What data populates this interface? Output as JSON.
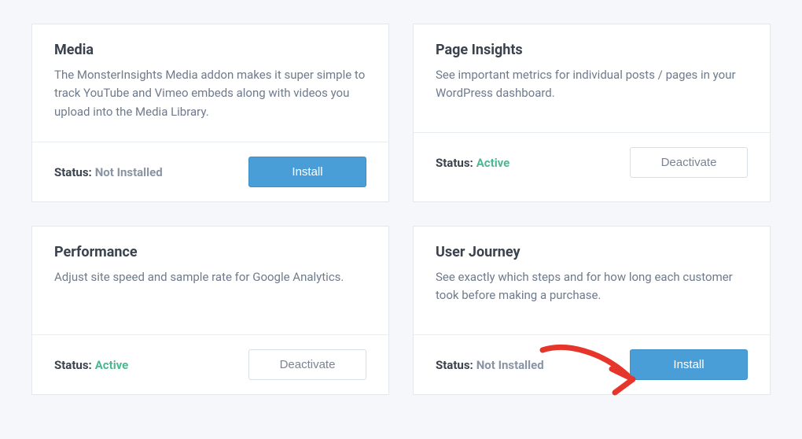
{
  "labels": {
    "status_prefix": "Status:"
  },
  "cards": [
    {
      "title": "Media",
      "description": "The MonsterInsights Media addon makes it super simple to track YouTube and Vimeo embeds along with videos you upload into the Media Library.",
      "status": "Not Installed",
      "status_class": "not-installed",
      "button": "Install",
      "button_style": "primary"
    },
    {
      "title": "Page Insights",
      "description": "See important metrics for individual posts / pages in your WordPress dashboard.",
      "status": "Active",
      "status_class": "active",
      "button": "Deactivate",
      "button_style": "secondary"
    },
    {
      "title": "Performance",
      "description": "Adjust site speed and sample rate for Google Analytics.",
      "status": "Active",
      "status_class": "active",
      "button": "Deactivate",
      "button_style": "secondary"
    },
    {
      "title": "User Journey",
      "description": "See exactly which steps and for how long each customer took before making a purchase.",
      "status": "Not Installed",
      "status_class": "not-installed",
      "button": "Install",
      "button_style": "primary"
    }
  ]
}
